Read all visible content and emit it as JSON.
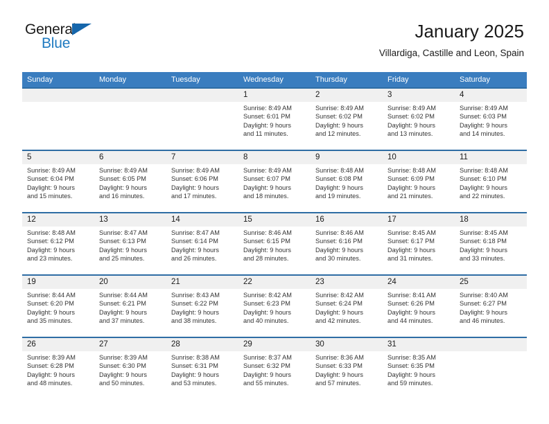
{
  "brand": {
    "name_part1": "General",
    "name_part2": "Blue",
    "accent_color": "#1f7ac0",
    "triangle_color": "#1666ab",
    "logo_icon": "triangle-logo-icon"
  },
  "header": {
    "title": "January 2025",
    "subtitle": "Villardiga, Castille and Leon, Spain"
  },
  "calendar": {
    "header_bg": "#3a7dbf",
    "row_divider_color": "#2e6da4",
    "daynum_band_bg": "#f0f0f0",
    "weekday_headers": [
      "Sunday",
      "Monday",
      "Tuesday",
      "Wednesday",
      "Thursday",
      "Friday",
      "Saturday"
    ],
    "weeks": [
      [
        {
          "day": "",
          "lines": []
        },
        {
          "day": "",
          "lines": []
        },
        {
          "day": "",
          "lines": []
        },
        {
          "day": "1",
          "lines": [
            "Sunrise: 8:49 AM",
            "Sunset: 6:01 PM",
            "Daylight: 9 hours",
            "and 11 minutes."
          ]
        },
        {
          "day": "2",
          "lines": [
            "Sunrise: 8:49 AM",
            "Sunset: 6:02 PM",
            "Daylight: 9 hours",
            "and 12 minutes."
          ]
        },
        {
          "day": "3",
          "lines": [
            "Sunrise: 8:49 AM",
            "Sunset: 6:02 PM",
            "Daylight: 9 hours",
            "and 13 minutes."
          ]
        },
        {
          "day": "4",
          "lines": [
            "Sunrise: 8:49 AM",
            "Sunset: 6:03 PM",
            "Daylight: 9 hours",
            "and 14 minutes."
          ]
        }
      ],
      [
        {
          "day": "5",
          "lines": [
            "Sunrise: 8:49 AM",
            "Sunset: 6:04 PM",
            "Daylight: 9 hours",
            "and 15 minutes."
          ]
        },
        {
          "day": "6",
          "lines": [
            "Sunrise: 8:49 AM",
            "Sunset: 6:05 PM",
            "Daylight: 9 hours",
            "and 16 minutes."
          ]
        },
        {
          "day": "7",
          "lines": [
            "Sunrise: 8:49 AM",
            "Sunset: 6:06 PM",
            "Daylight: 9 hours",
            "and 17 minutes."
          ]
        },
        {
          "day": "8",
          "lines": [
            "Sunrise: 8:49 AM",
            "Sunset: 6:07 PM",
            "Daylight: 9 hours",
            "and 18 minutes."
          ]
        },
        {
          "day": "9",
          "lines": [
            "Sunrise: 8:48 AM",
            "Sunset: 6:08 PM",
            "Daylight: 9 hours",
            "and 19 minutes."
          ]
        },
        {
          "day": "10",
          "lines": [
            "Sunrise: 8:48 AM",
            "Sunset: 6:09 PM",
            "Daylight: 9 hours",
            "and 21 minutes."
          ]
        },
        {
          "day": "11",
          "lines": [
            "Sunrise: 8:48 AM",
            "Sunset: 6:10 PM",
            "Daylight: 9 hours",
            "and 22 minutes."
          ]
        }
      ],
      [
        {
          "day": "12",
          "lines": [
            "Sunrise: 8:48 AM",
            "Sunset: 6:12 PM",
            "Daylight: 9 hours",
            "and 23 minutes."
          ]
        },
        {
          "day": "13",
          "lines": [
            "Sunrise: 8:47 AM",
            "Sunset: 6:13 PM",
            "Daylight: 9 hours",
            "and 25 minutes."
          ]
        },
        {
          "day": "14",
          "lines": [
            "Sunrise: 8:47 AM",
            "Sunset: 6:14 PM",
            "Daylight: 9 hours",
            "and 26 minutes."
          ]
        },
        {
          "day": "15",
          "lines": [
            "Sunrise: 8:46 AM",
            "Sunset: 6:15 PM",
            "Daylight: 9 hours",
            "and 28 minutes."
          ]
        },
        {
          "day": "16",
          "lines": [
            "Sunrise: 8:46 AM",
            "Sunset: 6:16 PM",
            "Daylight: 9 hours",
            "and 30 minutes."
          ]
        },
        {
          "day": "17",
          "lines": [
            "Sunrise: 8:45 AM",
            "Sunset: 6:17 PM",
            "Daylight: 9 hours",
            "and 31 minutes."
          ]
        },
        {
          "day": "18",
          "lines": [
            "Sunrise: 8:45 AM",
            "Sunset: 6:18 PM",
            "Daylight: 9 hours",
            "and 33 minutes."
          ]
        }
      ],
      [
        {
          "day": "19",
          "lines": [
            "Sunrise: 8:44 AM",
            "Sunset: 6:20 PM",
            "Daylight: 9 hours",
            "and 35 minutes."
          ]
        },
        {
          "day": "20",
          "lines": [
            "Sunrise: 8:44 AM",
            "Sunset: 6:21 PM",
            "Daylight: 9 hours",
            "and 37 minutes."
          ]
        },
        {
          "day": "21",
          "lines": [
            "Sunrise: 8:43 AM",
            "Sunset: 6:22 PM",
            "Daylight: 9 hours",
            "and 38 minutes."
          ]
        },
        {
          "day": "22",
          "lines": [
            "Sunrise: 8:42 AM",
            "Sunset: 6:23 PM",
            "Daylight: 9 hours",
            "and 40 minutes."
          ]
        },
        {
          "day": "23",
          "lines": [
            "Sunrise: 8:42 AM",
            "Sunset: 6:24 PM",
            "Daylight: 9 hours",
            "and 42 minutes."
          ]
        },
        {
          "day": "24",
          "lines": [
            "Sunrise: 8:41 AM",
            "Sunset: 6:26 PM",
            "Daylight: 9 hours",
            "and 44 minutes."
          ]
        },
        {
          "day": "25",
          "lines": [
            "Sunrise: 8:40 AM",
            "Sunset: 6:27 PM",
            "Daylight: 9 hours",
            "and 46 minutes."
          ]
        }
      ],
      [
        {
          "day": "26",
          "lines": [
            "Sunrise: 8:39 AM",
            "Sunset: 6:28 PM",
            "Daylight: 9 hours",
            "and 48 minutes."
          ]
        },
        {
          "day": "27",
          "lines": [
            "Sunrise: 8:39 AM",
            "Sunset: 6:30 PM",
            "Daylight: 9 hours",
            "and 50 minutes."
          ]
        },
        {
          "day": "28",
          "lines": [
            "Sunrise: 8:38 AM",
            "Sunset: 6:31 PM",
            "Daylight: 9 hours",
            "and 53 minutes."
          ]
        },
        {
          "day": "29",
          "lines": [
            "Sunrise: 8:37 AM",
            "Sunset: 6:32 PM",
            "Daylight: 9 hours",
            "and 55 minutes."
          ]
        },
        {
          "day": "30",
          "lines": [
            "Sunrise: 8:36 AM",
            "Sunset: 6:33 PM",
            "Daylight: 9 hours",
            "and 57 minutes."
          ]
        },
        {
          "day": "31",
          "lines": [
            "Sunrise: 8:35 AM",
            "Sunset: 6:35 PM",
            "Daylight: 9 hours",
            "and 59 minutes."
          ]
        },
        {
          "day": "",
          "lines": []
        }
      ]
    ]
  }
}
